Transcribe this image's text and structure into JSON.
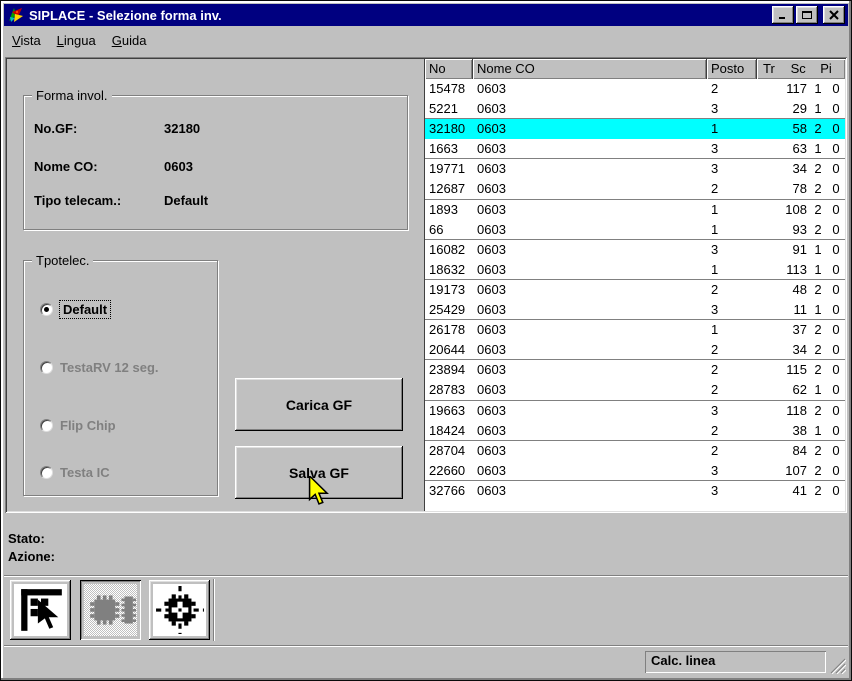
{
  "window": {
    "title": "SIPLACE - Selezione forma inv.",
    "controls": [
      "minimize",
      "maximize",
      "close"
    ]
  },
  "menu": {
    "items": [
      {
        "label": "Vista"
      },
      {
        "label": "Lingua"
      },
      {
        "label": "Guida"
      }
    ]
  },
  "forma_invol": {
    "title": "Forma invol.",
    "fields": [
      {
        "label": "No.GF:",
        "value": "32180"
      },
      {
        "label": "Nome CO:",
        "value": "0603"
      },
      {
        "label": "Tipo telecam.:",
        "value": "Default"
      }
    ]
  },
  "tpotelec": {
    "title": "Tpotelec.",
    "options": [
      {
        "label": "Default",
        "selected": true,
        "enabled": true
      },
      {
        "label": "TestaRV 12 seg.",
        "selected": false,
        "enabled": false
      },
      {
        "label": "Flip Chip",
        "selected": false,
        "enabled": false
      },
      {
        "label": "Testa IC",
        "selected": false,
        "enabled": false
      }
    ]
  },
  "buttons": {
    "carica": "Carica GF",
    "salva": "Salva GF"
  },
  "table": {
    "columns": [
      "No",
      "Nome CO",
      "Posto",
      "Tr",
      "Sc",
      "Pi"
    ],
    "selected_row_index": 2,
    "selection_color": "#00ffff",
    "rows": [
      [
        "15478",
        "0603",
        "2",
        "117",
        "1",
        "0"
      ],
      [
        "5221",
        "0603",
        "3",
        "29",
        "1",
        "0"
      ],
      [
        "32180",
        "0603",
        "1",
        "58",
        "2",
        "0"
      ],
      [
        "1663",
        "0603",
        "3",
        "63",
        "1",
        "0"
      ],
      [
        "19771",
        "0603",
        "3",
        "34",
        "2",
        "0"
      ],
      [
        "12687",
        "0603",
        "2",
        "78",
        "2",
        "0"
      ],
      [
        "1893",
        "0603",
        "1",
        "108",
        "2",
        "0"
      ],
      [
        "66",
        "0603",
        "1",
        "93",
        "2",
        "0"
      ],
      [
        "16082",
        "0603",
        "3",
        "91",
        "1",
        "0"
      ],
      [
        "18632",
        "0603",
        "1",
        "113",
        "1",
        "0"
      ],
      [
        "19173",
        "0603",
        "2",
        "48",
        "2",
        "0"
      ],
      [
        "25429",
        "0603",
        "3",
        "11",
        "1",
        "0"
      ],
      [
        "26178",
        "0603",
        "1",
        "37",
        "2",
        "0"
      ],
      [
        "20644",
        "0603",
        "2",
        "34",
        "2",
        "0"
      ],
      [
        "23894",
        "0603",
        "2",
        "115",
        "2",
        "0"
      ],
      [
        "28783",
        "0603",
        "2",
        "62",
        "1",
        "0"
      ],
      [
        "19663",
        "0603",
        "3",
        "118",
        "2",
        "0"
      ],
      [
        "18424",
        "0603",
        "2",
        "38",
        "1",
        "0"
      ],
      [
        "28704",
        "0603",
        "2",
        "84",
        "2",
        "0"
      ],
      [
        "22660",
        "0603",
        "3",
        "107",
        "2",
        "0"
      ],
      [
        "32766",
        "0603",
        "3",
        "41",
        "2",
        "0"
      ]
    ]
  },
  "status_labels": {
    "stato": "Stato:",
    "azione": "Azione:"
  },
  "toolbar": {
    "buttons": [
      {
        "icon": "select-arrow-icon",
        "pressed": false
      },
      {
        "icon": "component-chips-icon",
        "pressed": true
      },
      {
        "icon": "component-centering-icon",
        "pressed": false
      }
    ]
  },
  "statusbar": {
    "text": "Calc. linea"
  },
  "colors": {
    "titlebar": "#000080",
    "background": "#c0c0c0",
    "selection": "#00ffff",
    "disabled_text": "#808080",
    "cursor": "#ffff00"
  }
}
